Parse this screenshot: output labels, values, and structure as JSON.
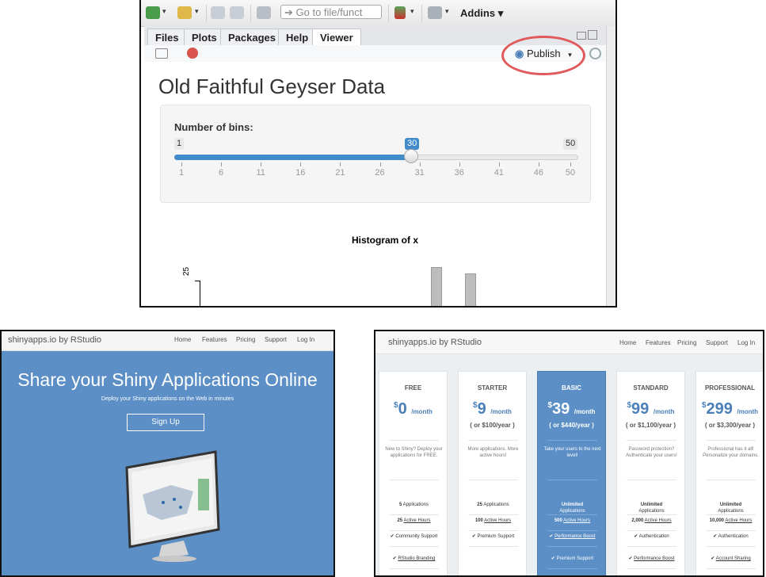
{
  "rstudio": {
    "toolbar": {
      "goto_placeholder": "Go to file/funct",
      "addins_label": "Addins",
      "caret": "▾"
    },
    "tabs": [
      {
        "label": "Files"
      },
      {
        "label": "Plots"
      },
      {
        "label": "Packages"
      },
      {
        "label": "Help"
      },
      {
        "label": "Viewer",
        "active": true
      }
    ],
    "publish_label": "Publish",
    "publish_caret": "▾",
    "app": {
      "title": "Old Faithful Geyser Data",
      "slider": {
        "label": "Number of bins:",
        "min": "1",
        "max": "50",
        "value": "30",
        "ticks": [
          "1",
          "6",
          "11",
          "16",
          "21",
          "26",
          "31",
          "36",
          "41",
          "46",
          "50"
        ]
      },
      "histogram": {
        "title": "Histogram of x",
        "y_tick": "25"
      }
    }
  },
  "landing": {
    "brand": "shinyapps.io by RStudio",
    "nav": [
      "Home",
      "Features",
      "Pricing",
      "Support",
      "Log In"
    ],
    "headline": "Share your Shiny Applications Online",
    "subheadline": "Deploy your Shiny applications on the Web in minutes",
    "signup_label": "Sign Up"
  },
  "pricing": {
    "brand": "shinyapps.io by RStudio",
    "nav": [
      "Home",
      "Features",
      "Pricing",
      "Support",
      "Log In"
    ],
    "currency": "$",
    "per_month": "/month",
    "plans": [
      {
        "name": "FREE",
        "price": "0",
        "annual": "",
        "desc": "New to Shiny? Deploy your applications for FREE.",
        "features": [
          {
            "bold": "5",
            "text": " Applications"
          },
          {
            "bold": "25",
            "link": "Active Hours"
          },
          {
            "check": true,
            "text": "Community Support"
          },
          {
            "check": true,
            "link": "RStudio Branding"
          }
        ]
      },
      {
        "name": "STARTER",
        "price": "9",
        "annual": "( or $100/year )",
        "desc": "More applications. More active hours!",
        "features": [
          {
            "bold": "25",
            "text": " Applications"
          },
          {
            "bold": "100",
            "link": "Active Hours"
          },
          {
            "check": true,
            "text": "Premium Support"
          }
        ]
      },
      {
        "name": "BASIC",
        "price": "39",
        "annual": "( or $440/year )",
        "highlight": true,
        "desc": "Take your users to the next level!",
        "features": [
          {
            "bold": "Unlimited",
            "text": "Applications"
          },
          {
            "bold": "500",
            "link": "Active Hours"
          },
          {
            "check": true,
            "link": "Performance Boost"
          },
          {
            "check": true,
            "text": "Premium Support"
          }
        ]
      },
      {
        "name": "STANDARD",
        "price": "99",
        "annual": "( or $1,100/year )",
        "desc": "Password protection? Authenticate your users!",
        "features": [
          {
            "bold": "Unlimited",
            "text": "Applications"
          },
          {
            "bold": "2,000",
            "link": "Active Hours"
          },
          {
            "check": true,
            "text": "Authentication"
          },
          {
            "check": true,
            "link": "Performance Boost"
          }
        ]
      },
      {
        "name": "PROFESSIONAL",
        "price": "299",
        "annual": "( or $3,300/year )",
        "desc": "Professional has it all! Personalize your domains.",
        "features": [
          {
            "bold": "Unlimited",
            "text": "Applications"
          },
          {
            "bold": "10,000",
            "link": "Active Hours"
          },
          {
            "check": true,
            "text": "Authentication"
          },
          {
            "check": true,
            "link": "Account Sharing"
          }
        ]
      }
    ]
  },
  "colors": {
    "shiny_blue": "#5b8fc5",
    "slider_blue": "#428bca",
    "highlight_ring": "#e0595b"
  }
}
